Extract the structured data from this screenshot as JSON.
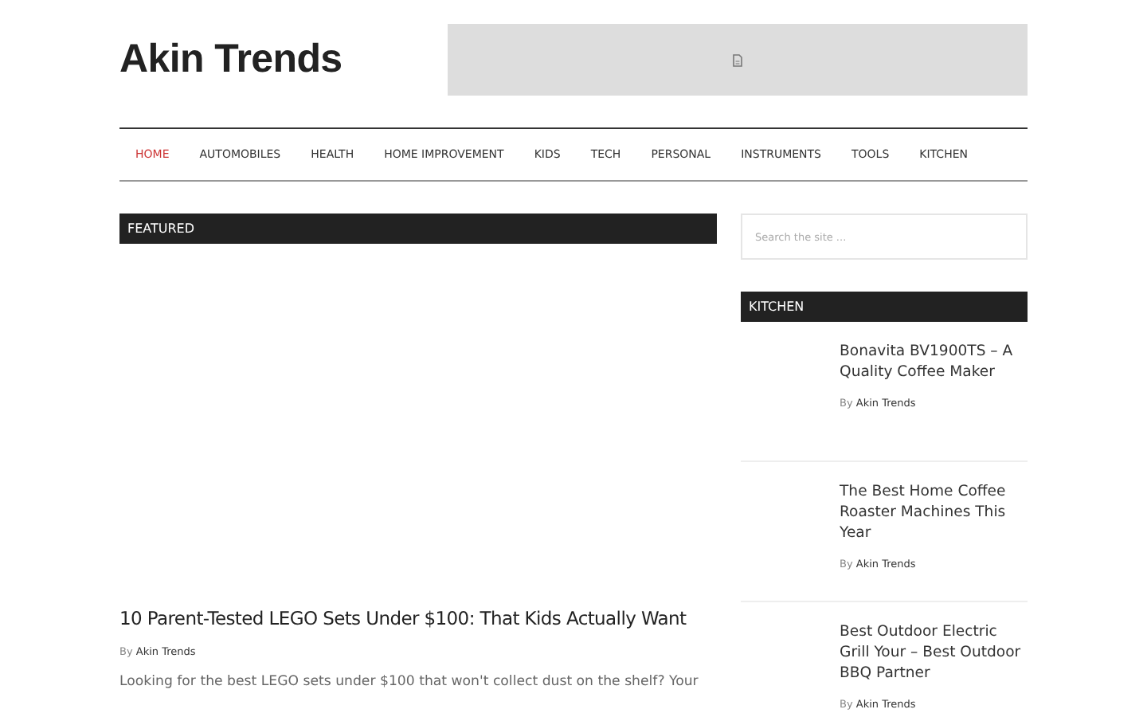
{
  "site": {
    "title": "Akin Trends"
  },
  "nav": [
    {
      "label": "HOME",
      "selected": true
    },
    {
      "label": "AUTOMOBILES",
      "selected": false
    },
    {
      "label": "HEALTH",
      "selected": false
    },
    {
      "label": "HOME IMPROVEMENT",
      "selected": false
    },
    {
      "label": "KIDS",
      "selected": false
    },
    {
      "label": "TECH",
      "selected": false
    },
    {
      "label": "PERSONAL",
      "selected": false
    },
    {
      "label": "INSTRUMENTS",
      "selected": false
    },
    {
      "label": "TOOLS",
      "selected": false
    },
    {
      "label": "KITCHEN",
      "selected": false
    }
  ],
  "featured": {
    "heading": "FEATURED",
    "post": {
      "title": "10 Parent-Tested LEGO Sets Under $100: That Kids Actually Want",
      "by": "By",
      "author": "Akin Trends",
      "excerpt": "Looking for the best LEGO sets under $100 that won't collect dust on the shelf? Your"
    }
  },
  "sidebar": {
    "search": {
      "placeholder": "Search the site ..."
    },
    "heading": "KITCHEN",
    "posts": [
      {
        "title": "Bonavita BV1900TS – A Quality Coffee Maker",
        "by": "By",
        "author": "Akin Trends"
      },
      {
        "title": "The Best Home Coffee Roaster Machines This Year",
        "by": "By",
        "author": "Akin Trends"
      },
      {
        "title": "Best Outdoor Electric Grill Your – Best Outdoor BBQ Partner",
        "by": "By",
        "author": "Akin Trends"
      }
    ]
  }
}
